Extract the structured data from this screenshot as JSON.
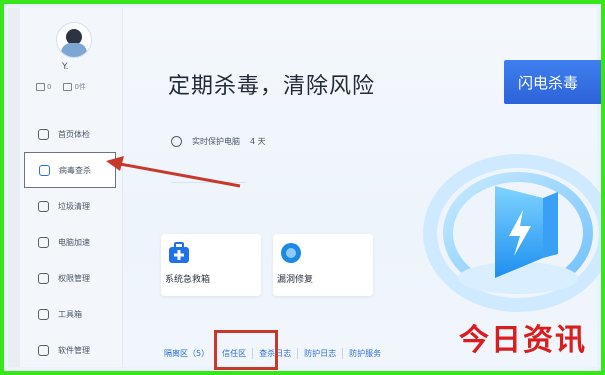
{
  "sidebar": {
    "username": "Y.",
    "stats": [
      {
        "label": "0",
        "icon": "message-icon"
      },
      {
        "label": "0件",
        "icon": "file-icon"
      }
    ],
    "items": [
      {
        "label": "首页体检",
        "icon": "monitor-icon",
        "name": "sidebar-item-home-check"
      },
      {
        "label": "病毒查杀",
        "icon": "shield-icon",
        "name": "sidebar-item-virus-scan",
        "active": true
      },
      {
        "label": "垃圾清理",
        "icon": "broom-icon",
        "name": "sidebar-item-cleanup"
      },
      {
        "label": "电脑加速",
        "icon": "rocket-icon",
        "name": "sidebar-item-speedup"
      },
      {
        "label": "权限管理",
        "icon": "lock-icon",
        "name": "sidebar-item-permissions"
      },
      {
        "label": "工具箱",
        "icon": "toolbox-icon",
        "name": "sidebar-item-toolbox"
      },
      {
        "label": "软件管理",
        "icon": "apps-icon",
        "name": "sidebar-item-software"
      }
    ]
  },
  "main": {
    "headline": "定期杀毒，清除风险",
    "scan_button": "闪电杀毒",
    "protection": {
      "label": "实时保护电脑",
      "value": "4 天"
    },
    "cards": [
      {
        "label": "系统急救箱",
        "icon": "first-aid-icon",
        "color": "#1f73e8"
      },
      {
        "label": "漏洞修复",
        "icon": "patch-icon",
        "color": "#1e88e5"
      }
    ],
    "tools": [
      "隔离区（5）",
      "信任区",
      "查杀日志",
      "防护日志",
      "防护服务"
    ]
  },
  "colors": {
    "accent": "#2d63d8",
    "highlight_red": "#c9392b",
    "frame_green": "#39e61b",
    "watermark_red": "#d81e1e"
  },
  "watermark": "今日资讯"
}
